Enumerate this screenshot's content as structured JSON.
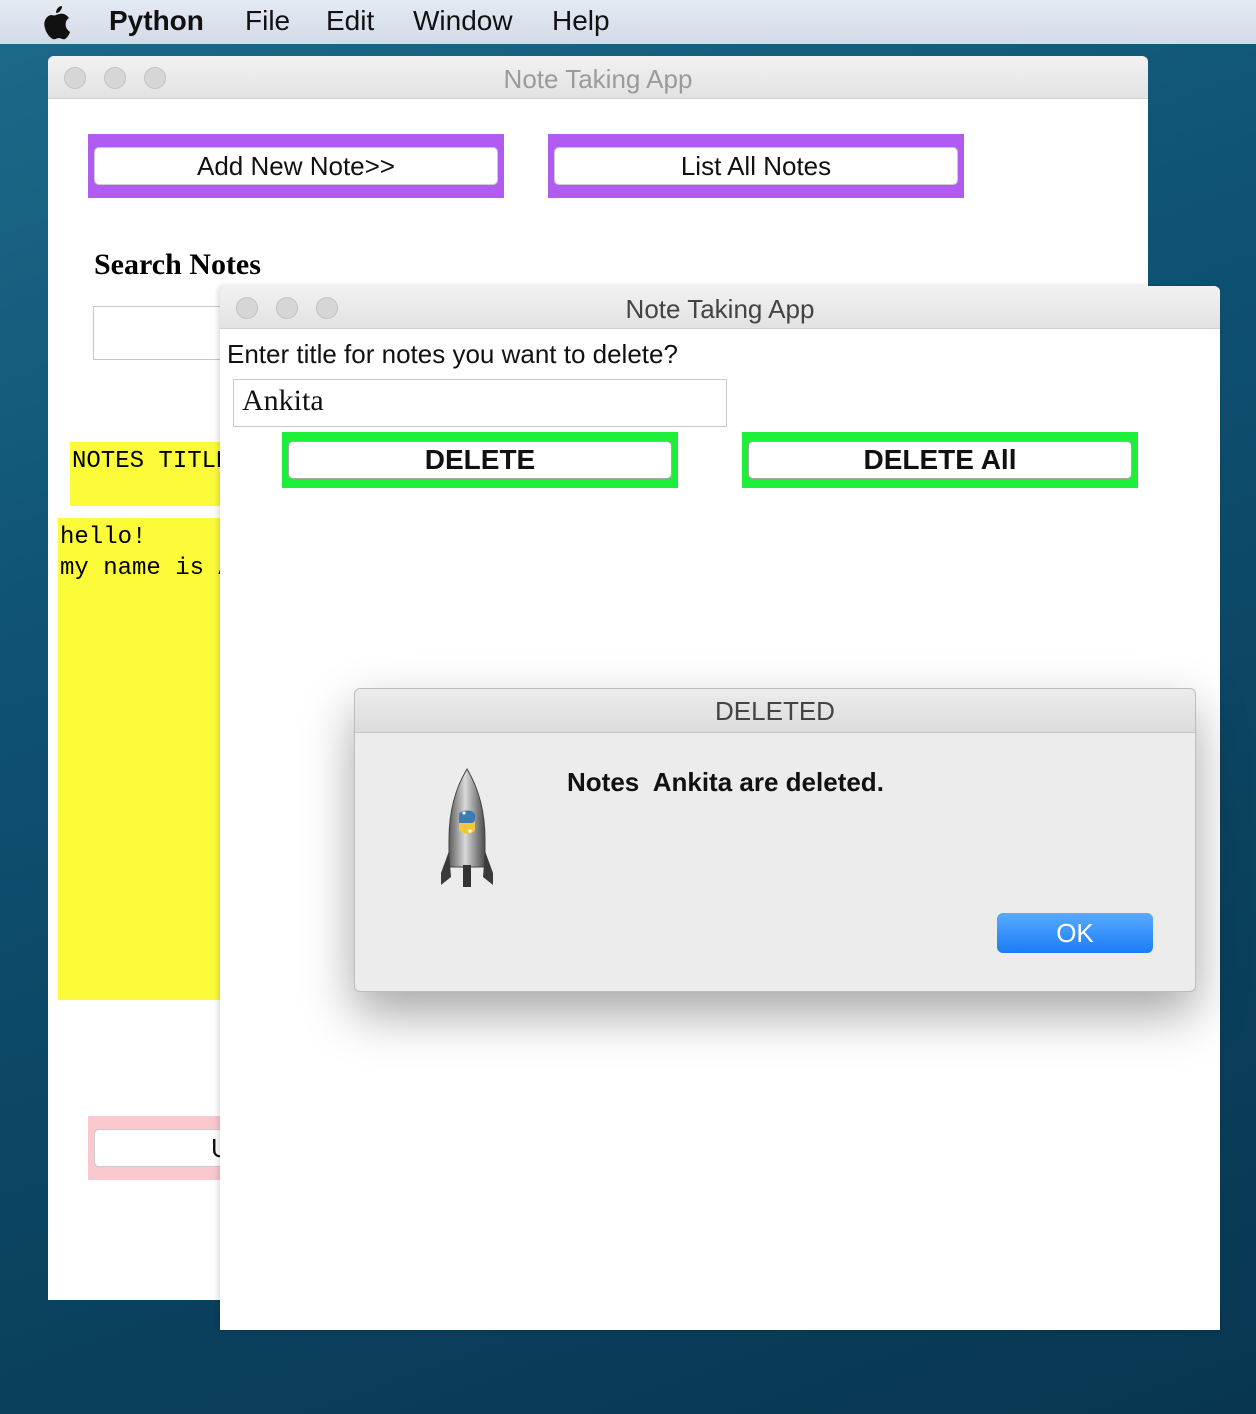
{
  "menubar": {
    "items": [
      "Python",
      "File",
      "Edit",
      "Window",
      "Help"
    ]
  },
  "back_window": {
    "title": "Note Taking App",
    "add_button": "Add New Note>>",
    "list_button": "List All Notes",
    "search_label": "Search Notes",
    "notes_title_header": "NOTES TITLE",
    "note_body": "hello!\nmy name is A",
    "bottom_button_partial": "U"
  },
  "front_window": {
    "title": "Note Taking App",
    "prompt": "Enter title for notes you want to delete?",
    "title_input_value": "Ankita",
    "delete_button": "DELETE",
    "delete_all_button": "DELETE All"
  },
  "alert": {
    "title": "DELETED",
    "message": "Notes  Ankita are deleted.",
    "ok_button": "OK",
    "icon": "python-launcher-rocket-icon"
  },
  "colors": {
    "purple_frame": "#b05cf0",
    "green_frame": "#1ef03a",
    "note_yellow": "#fbfb3a",
    "pink_frame": "#fbc8d0",
    "ok_blue": "#1b7cf6"
  }
}
